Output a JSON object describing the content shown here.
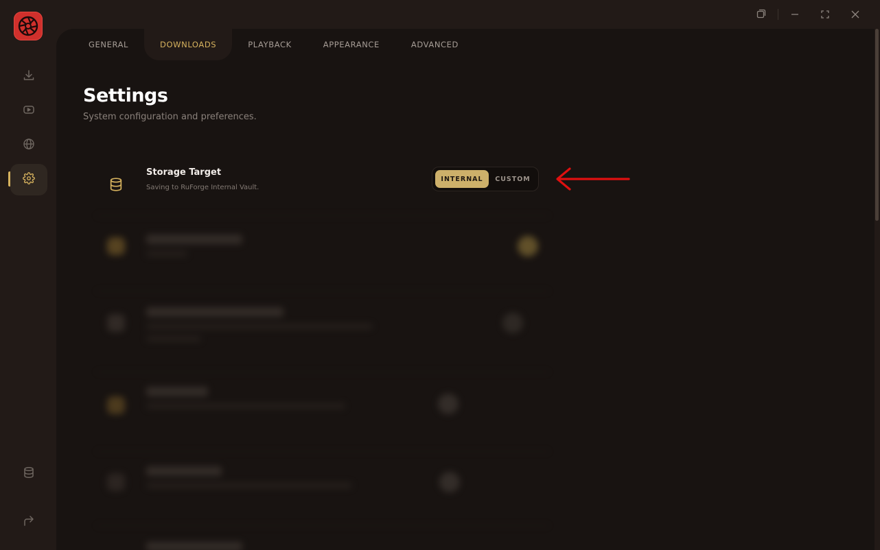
{
  "window": {
    "controls": [
      "restore-window",
      "minimize",
      "maximize",
      "close"
    ]
  },
  "sidebar": {
    "logo_icon": "aperture-logo-icon",
    "items": [
      {
        "icon": "download-icon",
        "active": false
      },
      {
        "icon": "video-icon",
        "active": false
      },
      {
        "icon": "globe-icon",
        "active": false
      },
      {
        "icon": "gear-icon",
        "active": true
      }
    ],
    "bottom_items": [
      {
        "icon": "database-icon"
      },
      {
        "icon": "logout-arrow-icon"
      }
    ]
  },
  "tabs": [
    {
      "label": "GENERAL",
      "active": false
    },
    {
      "label": "DOWNLOADS",
      "active": true
    },
    {
      "label": "PLAYBACK",
      "active": false
    },
    {
      "label": "APPEARANCE",
      "active": false
    },
    {
      "label": "ADVANCED",
      "active": false
    }
  ],
  "page": {
    "title": "Settings",
    "subtitle": "System configuration and preferences."
  },
  "storage": {
    "icon": "database-icon",
    "title": "Storage Target",
    "description": "Saving to RuForge Internal Vault.",
    "options": [
      {
        "label": "INTERNAL",
        "selected": true
      },
      {
        "label": "CUSTOM",
        "selected": false
      }
    ]
  },
  "colors": {
    "accent": "#d6b25e",
    "brand": "#d0302c",
    "annotation": "#e01010"
  }
}
